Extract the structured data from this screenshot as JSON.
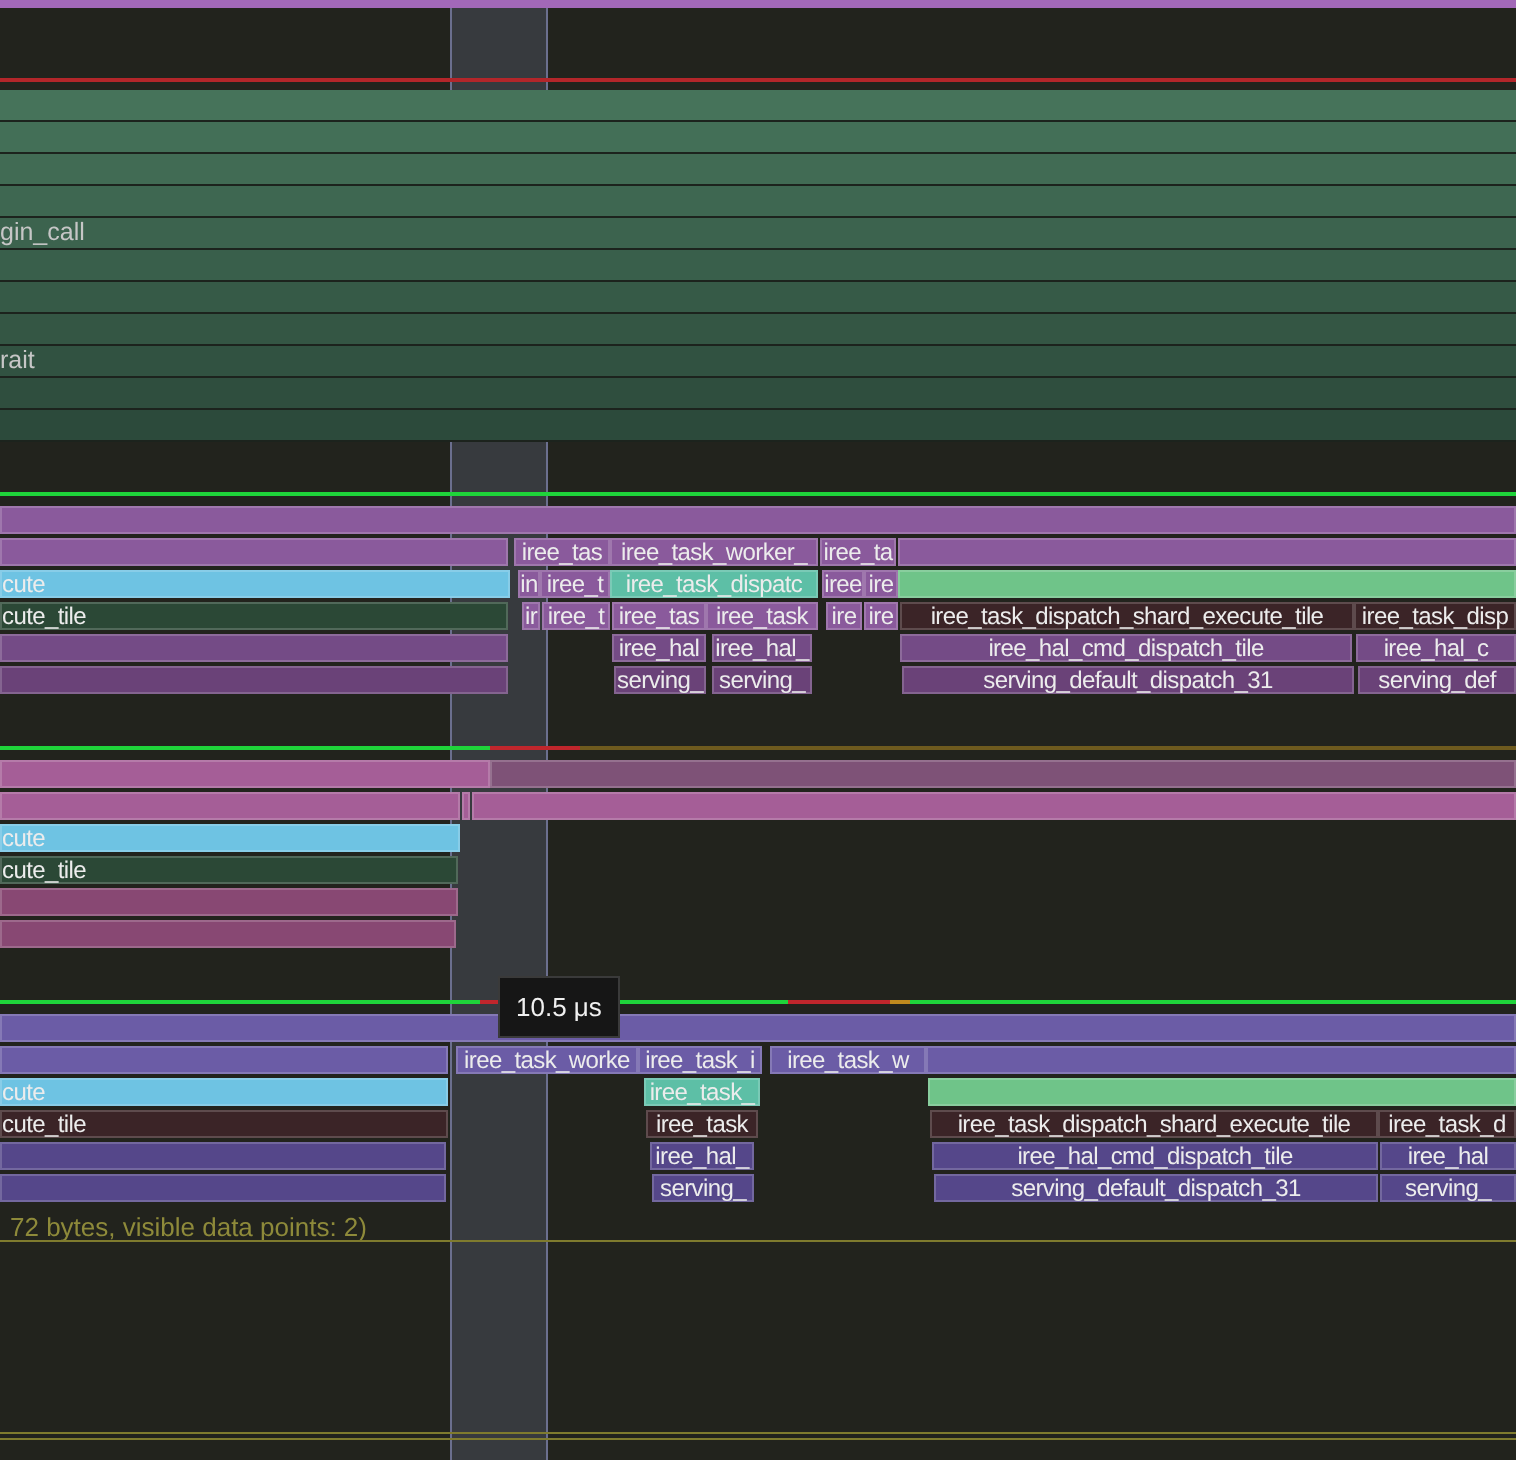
{
  "frame_rows": [
    {
      "kind": "frame"
    },
    {
      "kind": "frame"
    },
    {
      "kind": "frame"
    },
    {
      "kind": "frame"
    },
    {
      "kind": "frame",
      "label": "gin_call"
    },
    {
      "kind": "frame"
    },
    {
      "kind": "frame"
    },
    {
      "kind": "frame"
    },
    {
      "kind": "frame",
      "label": "rait"
    },
    {
      "kind": "frame"
    },
    {
      "kind": "frame"
    }
  ],
  "threads": [
    {
      "lanes": [
        {
          "zones": [
            {
              "kind": "purple"
            }
          ]
        },
        {
          "zones": [
            {
              "kind": "purple"
            },
            {
              "kind": "purple",
              "label": "iree_tas"
            },
            {
              "kind": "purple",
              "label": "iree_task_worker_"
            },
            {
              "kind": "purple",
              "label": "iree_ta"
            },
            {
              "kind": "purple"
            }
          ]
        },
        {
          "zones": [
            {
              "kind": "blue",
              "label": "cute"
            },
            {
              "kind": "purple",
              "label": "in"
            },
            {
              "kind": "purple",
              "label": "iree_t"
            },
            {
              "kind": "teal",
              "label": "iree_task_dispatc"
            },
            {
              "kind": "purple",
              "label": "iree"
            },
            {
              "kind": "purple",
              "label": "ire"
            },
            {
              "kind": "green"
            }
          ]
        },
        {
          "zones": [
            {
              "kind": "darkgreen",
              "label": "cute_tile"
            },
            {
              "kind": "purple",
              "label": "ir"
            },
            {
              "kind": "purple",
              "label": "iree_t"
            },
            {
              "kind": "purple",
              "label": "iree_tas"
            },
            {
              "kind": "purple",
              "label": "iree_task"
            },
            {
              "kind": "purple",
              "label": "ire"
            },
            {
              "kind": "purple",
              "label": "ire"
            },
            {
              "kind": "maroon",
              "label": "iree_task_dispatch_shard_execute_tile"
            },
            {
              "kind": "maroon",
              "label": "iree_task_disp"
            }
          ]
        },
        {
          "zones": [
            {
              "kind": "violet"
            },
            {
              "kind": "violet",
              "label": "iree_hal"
            },
            {
              "kind": "violet",
              "label": "iree_hal_"
            },
            {
              "kind": "violet",
              "label": "iree_hal_cmd_dispatch_tile"
            },
            {
              "kind": "violet",
              "label": "iree_hal_c"
            }
          ]
        },
        {
          "zones": [
            {
              "kind": "plum"
            },
            {
              "kind": "plum",
              "label": "serving_"
            },
            {
              "kind": "plum",
              "label": "serving_"
            },
            {
              "kind": "plum",
              "label": "serving_default_dispatch_31"
            },
            {
              "kind": "plum",
              "label": "serving_def"
            }
          ]
        }
      ]
    },
    {
      "lanes": [
        {
          "zones": [
            {
              "kind": "pink"
            },
            {
              "kind": "pinkdim"
            }
          ]
        },
        {
          "zones": [
            {
              "kind": "pink"
            },
            {
              "kind": "pink"
            },
            {
              "kind": "pink"
            }
          ]
        },
        {
          "zones": [
            {
              "kind": "blue",
              "label": "cute"
            }
          ]
        },
        {
          "zones": [
            {
              "kind": "darkgreen",
              "label": "cute_tile"
            }
          ]
        },
        {
          "zones": [
            {
              "kind": "rose"
            }
          ]
        },
        {
          "zones": [
            {
              "kind": "rose"
            }
          ]
        }
      ]
    },
    {
      "lanes": [
        {
          "zones": [
            {
              "kind": "indigo"
            }
          ]
        },
        {
          "zones": [
            {
              "kind": "indigo"
            },
            {
              "kind": "indigo",
              "label": "iree_task_worke"
            },
            {
              "kind": "indigo",
              "label": "iree_task_i"
            },
            {
              "kind": "indigo",
              "label": "iree_task_w"
            },
            {
              "kind": "indigo"
            }
          ]
        },
        {
          "zones": [
            {
              "kind": "blue",
              "label": "cute"
            },
            {
              "kind": "teal",
              "label": "iree_task_"
            },
            {
              "kind": "green"
            }
          ]
        },
        {
          "zones": [
            {
              "kind": "maroon",
              "label": "cute_tile"
            },
            {
              "kind": "maroon",
              "label": "iree_task"
            },
            {
              "kind": "maroon",
              "label": "iree_task_dispatch_shard_execute_tile"
            },
            {
              "kind": "maroon",
              "label": "iree_task_d"
            }
          ]
        },
        {
          "zones": [
            {
              "kind": "slate"
            },
            {
              "kind": "slate",
              "label": "iree_hal_"
            },
            {
              "kind": "slate",
              "label": "iree_hal_cmd_dispatch_tile"
            },
            {
              "kind": "slate",
              "label": "iree_hal"
            }
          ]
        },
        {
          "zones": [
            {
              "kind": "slate"
            },
            {
              "kind": "slate",
              "label": "serving_"
            },
            {
              "kind": "slate",
              "label": "serving_default_dispatch_31"
            },
            {
              "kind": "slate",
              "label": "serving_"
            }
          ]
        }
      ]
    }
  ],
  "plot": {
    "label": "72 bytes, visible data points: 2)"
  },
  "tooltip": {
    "text": "10.5 μs"
  }
}
